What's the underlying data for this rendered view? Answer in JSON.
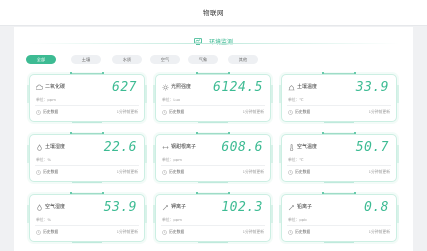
{
  "app": {
    "title": "物联网"
  },
  "section": {
    "title": "环境监测"
  },
  "filters": [
    {
      "label": "全部",
      "active": true
    },
    {
      "label": "土壤",
      "active": false
    },
    {
      "label": "水质",
      "active": false
    },
    {
      "label": "空气",
      "active": false
    },
    {
      "label": "气象",
      "active": false
    },
    {
      "label": "其他",
      "active": false
    }
  ],
  "cards": [
    {
      "name": "二氧化碳",
      "value": "627",
      "unit": "单位：ppm",
      "history": "历史数据",
      "update": "1分钟前更新",
      "icon": "co2-icon"
    },
    {
      "name": "光照强度",
      "value": "6124.5",
      "unit": "单位：Lux",
      "history": "历史数据",
      "update": "1分钟前更新",
      "icon": "sun-icon"
    },
    {
      "name": "土壤温度",
      "value": "33.9",
      "unit": "单位：℃",
      "history": "历史数据",
      "update": "1分钟前更新",
      "icon": "soil-temp-icon"
    },
    {
      "name": "土壤湿度",
      "value": "22.6",
      "unit": "单位：%",
      "history": "历史数据",
      "update": "1分钟前更新",
      "icon": "soil-humidity-icon"
    },
    {
      "name": "钢甜根离子",
      "value": "608.6",
      "unit": "单位：ppm",
      "history": "历史数据",
      "update": "1分钟前更新",
      "icon": "ion-icon"
    },
    {
      "name": "空气温度",
      "value": "50.7",
      "unit": "单位：℃",
      "history": "历史数据",
      "update": "1分钟前更新",
      "icon": "thermometer-icon"
    },
    {
      "name": "空气湿度",
      "value": "53.9",
      "unit": "单位：%",
      "history": "历史数据",
      "update": "1分钟前更新",
      "icon": "droplet-icon"
    },
    {
      "name": "钾离子",
      "value": "102.3",
      "unit": "单位：ppm",
      "history": "历史数据",
      "update": "1分钟前更新",
      "icon": "potassium-icon"
    },
    {
      "name": "铅离子",
      "value": "0.8",
      "unit": "单位：ppb",
      "history": "历史数据",
      "update": "1分钟前更新",
      "icon": "lead-icon"
    }
  ],
  "colors": {
    "accent": "#3dbb93",
    "chip_bg": "#eef0f3",
    "card_border": "#ccefe3"
  }
}
